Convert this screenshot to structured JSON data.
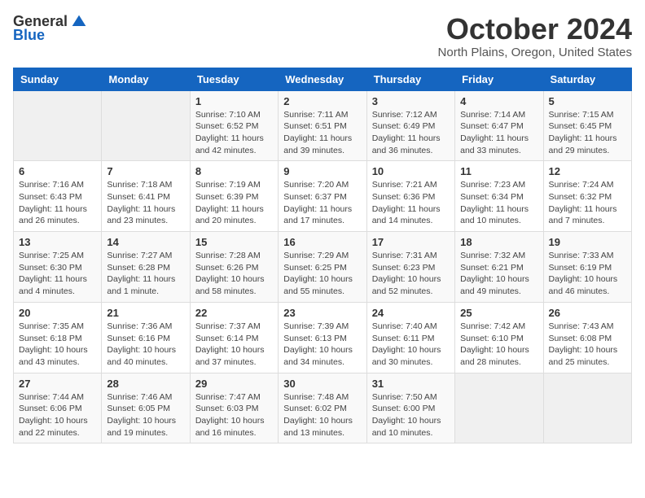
{
  "logo": {
    "general": "General",
    "blue": "Blue"
  },
  "header": {
    "month": "October 2024",
    "location": "North Plains, Oregon, United States"
  },
  "weekdays": [
    "Sunday",
    "Monday",
    "Tuesday",
    "Wednesday",
    "Thursday",
    "Friday",
    "Saturday"
  ],
  "weeks": [
    [
      {
        "day": "",
        "info": ""
      },
      {
        "day": "",
        "info": ""
      },
      {
        "day": "1",
        "info": "Sunrise: 7:10 AM\nSunset: 6:52 PM\nDaylight: 11 hours and 42 minutes."
      },
      {
        "day": "2",
        "info": "Sunrise: 7:11 AM\nSunset: 6:51 PM\nDaylight: 11 hours and 39 minutes."
      },
      {
        "day": "3",
        "info": "Sunrise: 7:12 AM\nSunset: 6:49 PM\nDaylight: 11 hours and 36 minutes."
      },
      {
        "day": "4",
        "info": "Sunrise: 7:14 AM\nSunset: 6:47 PM\nDaylight: 11 hours and 33 minutes."
      },
      {
        "day": "5",
        "info": "Sunrise: 7:15 AM\nSunset: 6:45 PM\nDaylight: 11 hours and 29 minutes."
      }
    ],
    [
      {
        "day": "6",
        "info": "Sunrise: 7:16 AM\nSunset: 6:43 PM\nDaylight: 11 hours and 26 minutes."
      },
      {
        "day": "7",
        "info": "Sunrise: 7:18 AM\nSunset: 6:41 PM\nDaylight: 11 hours and 23 minutes."
      },
      {
        "day": "8",
        "info": "Sunrise: 7:19 AM\nSunset: 6:39 PM\nDaylight: 11 hours and 20 minutes."
      },
      {
        "day": "9",
        "info": "Sunrise: 7:20 AM\nSunset: 6:37 PM\nDaylight: 11 hours and 17 minutes."
      },
      {
        "day": "10",
        "info": "Sunrise: 7:21 AM\nSunset: 6:36 PM\nDaylight: 11 hours and 14 minutes."
      },
      {
        "day": "11",
        "info": "Sunrise: 7:23 AM\nSunset: 6:34 PM\nDaylight: 11 hours and 10 minutes."
      },
      {
        "day": "12",
        "info": "Sunrise: 7:24 AM\nSunset: 6:32 PM\nDaylight: 11 hours and 7 minutes."
      }
    ],
    [
      {
        "day": "13",
        "info": "Sunrise: 7:25 AM\nSunset: 6:30 PM\nDaylight: 11 hours and 4 minutes."
      },
      {
        "day": "14",
        "info": "Sunrise: 7:27 AM\nSunset: 6:28 PM\nDaylight: 11 hours and 1 minute."
      },
      {
        "day": "15",
        "info": "Sunrise: 7:28 AM\nSunset: 6:26 PM\nDaylight: 10 hours and 58 minutes."
      },
      {
        "day": "16",
        "info": "Sunrise: 7:29 AM\nSunset: 6:25 PM\nDaylight: 10 hours and 55 minutes."
      },
      {
        "day": "17",
        "info": "Sunrise: 7:31 AM\nSunset: 6:23 PM\nDaylight: 10 hours and 52 minutes."
      },
      {
        "day": "18",
        "info": "Sunrise: 7:32 AM\nSunset: 6:21 PM\nDaylight: 10 hours and 49 minutes."
      },
      {
        "day": "19",
        "info": "Sunrise: 7:33 AM\nSunset: 6:19 PM\nDaylight: 10 hours and 46 minutes."
      }
    ],
    [
      {
        "day": "20",
        "info": "Sunrise: 7:35 AM\nSunset: 6:18 PM\nDaylight: 10 hours and 43 minutes."
      },
      {
        "day": "21",
        "info": "Sunrise: 7:36 AM\nSunset: 6:16 PM\nDaylight: 10 hours and 40 minutes."
      },
      {
        "day": "22",
        "info": "Sunrise: 7:37 AM\nSunset: 6:14 PM\nDaylight: 10 hours and 37 minutes."
      },
      {
        "day": "23",
        "info": "Sunrise: 7:39 AM\nSunset: 6:13 PM\nDaylight: 10 hours and 34 minutes."
      },
      {
        "day": "24",
        "info": "Sunrise: 7:40 AM\nSunset: 6:11 PM\nDaylight: 10 hours and 30 minutes."
      },
      {
        "day": "25",
        "info": "Sunrise: 7:42 AM\nSunset: 6:10 PM\nDaylight: 10 hours and 28 minutes."
      },
      {
        "day": "26",
        "info": "Sunrise: 7:43 AM\nSunset: 6:08 PM\nDaylight: 10 hours and 25 minutes."
      }
    ],
    [
      {
        "day": "27",
        "info": "Sunrise: 7:44 AM\nSunset: 6:06 PM\nDaylight: 10 hours and 22 minutes."
      },
      {
        "day": "28",
        "info": "Sunrise: 7:46 AM\nSunset: 6:05 PM\nDaylight: 10 hours and 19 minutes."
      },
      {
        "day": "29",
        "info": "Sunrise: 7:47 AM\nSunset: 6:03 PM\nDaylight: 10 hours and 16 minutes."
      },
      {
        "day": "30",
        "info": "Sunrise: 7:48 AM\nSunset: 6:02 PM\nDaylight: 10 hours and 13 minutes."
      },
      {
        "day": "31",
        "info": "Sunrise: 7:50 AM\nSunset: 6:00 PM\nDaylight: 10 hours and 10 minutes."
      },
      {
        "day": "",
        "info": ""
      },
      {
        "day": "",
        "info": ""
      }
    ]
  ]
}
